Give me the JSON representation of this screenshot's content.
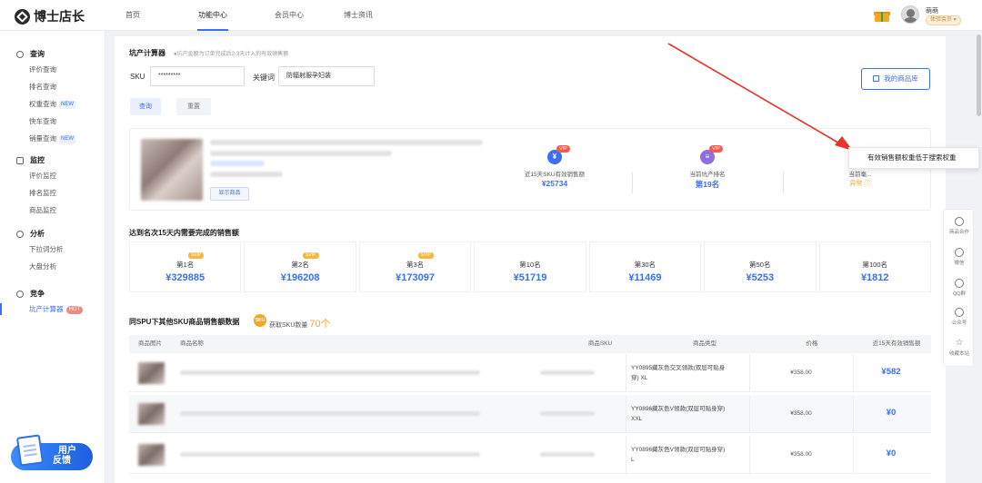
{
  "header": {
    "logo_text": "博士店长",
    "nav": [
      "首页",
      "功能中心",
      "会员中心",
      "博士资讯"
    ],
    "active_nav": 1,
    "user_name": "萌萌",
    "user_badge": "体验会员 ▾"
  },
  "sidebar": {
    "groups": [
      {
        "title": "查询",
        "items": [
          {
            "label": "评价查询",
            "tag": ""
          },
          {
            "label": "排名查询",
            "tag": ""
          },
          {
            "label": "权重查询",
            "tag": "NEW"
          },
          {
            "label": "快车查询",
            "tag": ""
          },
          {
            "label": "销量查询",
            "tag": "NEW"
          }
        ]
      },
      {
        "title": "监控",
        "items": [
          {
            "label": "评价监控",
            "tag": ""
          },
          {
            "label": "排名监控",
            "tag": ""
          },
          {
            "label": "商品监控",
            "tag": ""
          }
        ]
      },
      {
        "title": "分析",
        "items": [
          {
            "label": "下拉词分析",
            "tag": ""
          },
          {
            "label": "大盘分析",
            "tag": ""
          }
        ]
      },
      {
        "title": "竞争",
        "items": [
          {
            "label": "坑产计算器",
            "tag": "HOT"
          }
        ]
      }
    ],
    "feedback_line1": "用户",
    "feedback_line2": "反馈"
  },
  "form": {
    "title": "坑产计算器",
    "hint": "●坑产金额为订单完成后2-3天计入的有效销售额",
    "sku_label": "SKU",
    "sku_value": "*********",
    "keyword_label": "关键词",
    "keyword_value": "防辐射服孕妇装",
    "query_button": "查询",
    "reset_button": "重置",
    "my_library_button": "我的商品库"
  },
  "product": {
    "show_button": "显示商品",
    "metrics": [
      {
        "label": "近15天SKU有效销售额",
        "value": "¥25734",
        "vip": "VIP",
        "icon": "¥",
        "color": "#3a6ff7"
      },
      {
        "label": "当前坑产排名",
        "value": "第19名",
        "vip": "VIP",
        "icon": "≡",
        "color": "#8f6fe0"
      },
      {
        "label": "当前毫...",
        "value": "异常 ⓘ",
        "vip": "",
        "icon": "",
        "color": "#28b7a8"
      }
    ],
    "tooltip": "有效销售额权重低于搜索权重"
  },
  "ranks": {
    "title": "达到名次15天内需要完成的销售额",
    "items": [
      {
        "name": "第1名",
        "value": "¥329885",
        "tag": "SVIP"
      },
      {
        "name": "第2名",
        "value": "¥196208",
        "tag": "SVIP"
      },
      {
        "name": "第3名",
        "value": "¥173097",
        "tag": "SVIP"
      },
      {
        "name": "第10名",
        "value": "¥51719",
        "tag": ""
      },
      {
        "name": "第30名",
        "value": "¥11469",
        "tag": ""
      },
      {
        "name": "第50名",
        "value": "¥5253",
        "tag": ""
      },
      {
        "name": "第100名",
        "value": "¥1812",
        "tag": ""
      }
    ]
  },
  "spu": {
    "title": "同SPU下其他SKU商品销售额数据",
    "badge": "SKU",
    "count_label": "获取SKU数量",
    "count_value": "70个",
    "columns": [
      "商品图片",
      "商品名称",
      "商品SKU",
      "商品类型",
      "价格",
      "近15天有效销售额"
    ],
    "rows": [
      {
        "type": "YY0895藏灰色交叉领款(双层可贴身穿)  XL",
        "price": "¥358.00",
        "sales": "¥582"
      },
      {
        "type": "YY0896藏灰色V领款(双层可贴身穿)  XXL",
        "price": "¥358.00",
        "sales": "¥0"
      },
      {
        "type": "YY0896藏灰色V领款(双层可贴身穿)  L",
        "price": "¥358.00",
        "sales": "¥0"
      }
    ]
  },
  "rightbar": [
    "商品合作",
    "微信",
    "QQ群",
    "公众号",
    "收藏本站"
  ]
}
